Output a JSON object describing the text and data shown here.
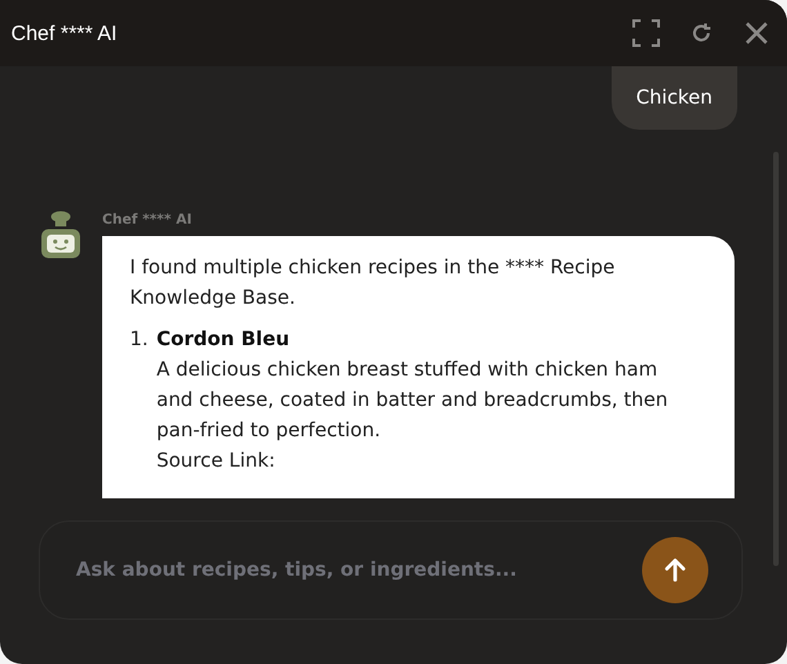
{
  "window": {
    "title": "Chef **** AI"
  },
  "messages": [
    {
      "kind": "user",
      "text": "Chicken"
    },
    {
      "kind": "bot",
      "sender": "Chef **** AI",
      "intro": "I found multiple chicken recipes in the **** Recipe Knowledge Base.",
      "items": [
        {
          "number": "1.",
          "title": "Cordon Bleu",
          "description": "A delicious chicken breast stuffed with chicken ham and cheese, coated in batter and breadcrumbs, then pan-fried to perfection.",
          "source_label": "Source Link:"
        }
      ]
    }
  ],
  "composer": {
    "placeholder": "Ask about recipes, tips, or ingredients..."
  }
}
